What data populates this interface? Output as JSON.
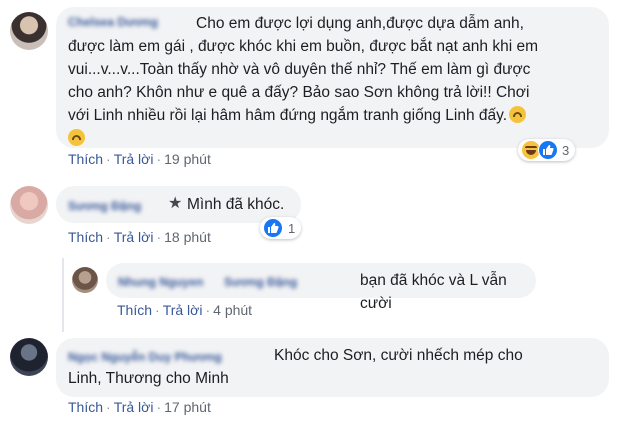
{
  "comments": [
    {
      "author": "Chelsea Dương",
      "lines": [
        "Cho em được lợi dụng anh,được dựa dẫm anh,",
        "được làm em gái , được khóc khi em buồn, được bắt nạt anh khi em",
        "vui...v...v...Toàn thấy nhờ và vô duyên thế nhỉ? Thế em làm gì được",
        "cho anh? Khôn như e quê a đấy? Bảo sao Sơn không trả lời!! Chơi",
        "với Linh nhiều rồi lại hâm hâm đứng ngắm tranh giống Linh đấy."
      ],
      "like_label": "Thích",
      "reply_label": "Trả lời",
      "time": "19 phút",
      "reaction_count": "3"
    },
    {
      "author": "Sương Đặng",
      "text": "Mình đã khóc.",
      "like_label": "Thích",
      "reply_label": "Trả lời",
      "time": "18 phút",
      "reaction_count": "1"
    },
    {
      "author": "Nhung Nguyen",
      "mention": "Sương Đặng",
      "text": "bạn đã khóc và L vẫn cười",
      "like_label": "Thích",
      "reply_label": "Trả lời",
      "time": "4 phút"
    },
    {
      "author": "Ngọc Nguyễn Duy Phương",
      "lines": [
        "Khóc cho Sơn, cười nhếch mép cho",
        "Linh, Thương cho Minh"
      ],
      "like_label": "Thích",
      "reply_label": "Trả lời",
      "time": "17 phút"
    }
  ],
  "separator": "·",
  "icons": {
    "emoji": "upside-down-face-icon",
    "star": "star-icon",
    "haha": "haha-reaction-icon",
    "like": "like-reaction-icon"
  },
  "colors": {
    "link": "#385898",
    "bubble": "#f2f3f5",
    "like_blue": "#1877f2"
  }
}
